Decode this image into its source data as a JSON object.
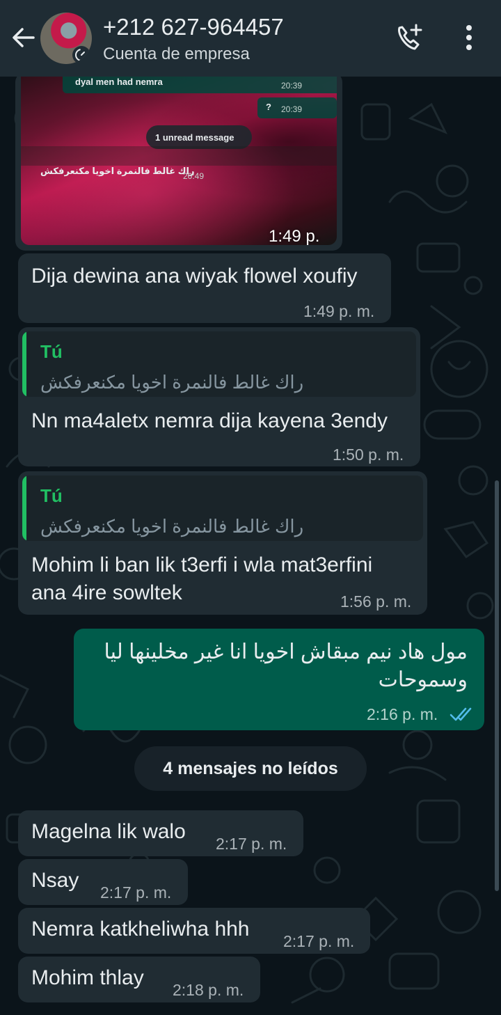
{
  "header": {
    "title": "+212 627-964457",
    "subtitle": "Cuenta de empresa",
    "colors": {
      "bar": "#1f2c34",
      "text": "#e9edef"
    },
    "icons": [
      "back-arrow-icon",
      "business-badge-icon",
      "add-call-icon",
      "more-vert-icon"
    ]
  },
  "image_message": {
    "time": "1:49 p. m.",
    "screenshot_lines": {
      "line1": "dyal men had nemra",
      "line1_time": "20:39",
      "line2": "?",
      "line2_time": "20:39",
      "pill": "1 unread message",
      "line3": "راك غالط فالنمرة اخويا مكنعرفكش",
      "line3_time": "20:49"
    }
  },
  "messages": [
    {
      "text": "Dija dewina ana wiyak flowel xoufiy",
      "time": "1:49 p. m."
    },
    {
      "quote_author": "Tú",
      "quote_text": "راك غالط فالنمرة اخويا مكنعرفكش",
      "text": "Nn ma4aletx nemra dija kayena 3endy",
      "time": "1:50 p. m."
    },
    {
      "quote_author": "Tú",
      "quote_text": "راك غالط فالنمرة اخويا مكنعرفكش",
      "text_line1": "Mohim li ban lik t3erfi i wla mat3erfini",
      "text_line2": "ana 4ire sowltek",
      "time": "1:56 p. m."
    },
    {
      "text_line1": "مول هاد نيم مبقاش اخويا انا غير مخلينها ليا",
      "text_line2": "وسموحات",
      "time": "2:16 p. m.",
      "status": "read-double-check-icon"
    },
    {
      "text": "Magelna lik walo",
      "time": "2:17 p. m."
    },
    {
      "text": "Nsay",
      "time": "2:17 p. m."
    },
    {
      "text": "Nemra katkheliwha hhh",
      "time": "2:17 p. m."
    },
    {
      "text": "Mohim thlay",
      "time": "2:18 p. m."
    }
  ],
  "unread_divider": "4 mensajes no leídos",
  "colors": {
    "background": "#0b141a",
    "incoming": "#202c33",
    "outgoing": "#005c4b",
    "quote_accent": "#21c063",
    "read_ticks": "#53bdeb"
  }
}
